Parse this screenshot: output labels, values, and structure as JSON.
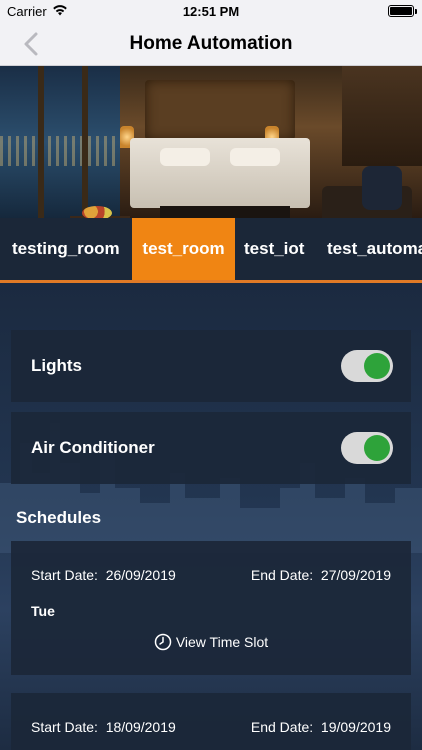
{
  "status_bar": {
    "carrier": "Carrier",
    "time": "12:51 PM"
  },
  "nav": {
    "title": "Home Automation"
  },
  "tabs": [
    {
      "label": "testing_room",
      "active": false
    },
    {
      "label": "test_room",
      "active": true
    },
    {
      "label": "test_iot",
      "active": false
    },
    {
      "label": "test_automa",
      "active": false
    }
  ],
  "devices": [
    {
      "label": "Lights",
      "on": true
    },
    {
      "label": "Air Conditioner",
      "on": true
    }
  ],
  "schedules_title": "Schedules",
  "schedules": [
    {
      "start_label": "Start Date:",
      "start": "26/09/2019",
      "end_label": "End Date:",
      "end": "27/09/2019",
      "day": "Tue",
      "slot_label": "View Time  Slot"
    },
    {
      "start_label": "Start Date:",
      "start": "18/09/2019",
      "end_label": "End Date:",
      "end": "19/09/2019",
      "day": "",
      "slot_label": ""
    }
  ],
  "colors": {
    "accent": "#f08513",
    "toggle_on": "#2ea33a",
    "card": "#1b2738"
  }
}
